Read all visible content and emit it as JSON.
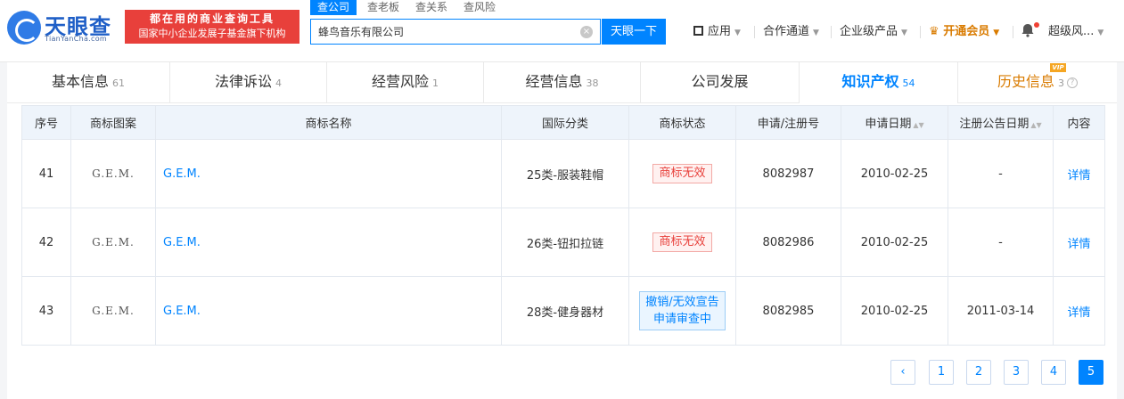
{
  "header": {
    "logo_text": "天眼查",
    "logo_sub": "TianYanCha.com",
    "promo_line1": "都在用的商业查询工具",
    "promo_line2": "国家中小企业发展子基金旗下机构",
    "search_tabs": [
      "查公司",
      "查老板",
      "查关系",
      "查风险"
    ],
    "search_value": "蜂鸟音乐有限公司",
    "clear_icon": "×",
    "search_button": "天眼一下",
    "nav": {
      "apps": "应用",
      "partner": "合作通道",
      "enterprise": "企业级产品",
      "vip": "开通会员",
      "user": "超级风..."
    }
  },
  "tabs": [
    {
      "label": "基本信息",
      "count": "61"
    },
    {
      "label": "法律诉讼",
      "count": "4"
    },
    {
      "label": "经营风险",
      "count": "1"
    },
    {
      "label": "经营信息",
      "count": "38"
    },
    {
      "label": "公司发展",
      "count": ""
    },
    {
      "label": "知识产权",
      "count": "54"
    },
    {
      "label": "历史信息",
      "count": "3"
    }
  ],
  "vip_badge": "VIP",
  "table": {
    "headers": [
      "序号",
      "商标图案",
      "商标名称",
      "国际分类",
      "商标状态",
      "申请/注册号",
      "申请日期",
      "注册公告日期",
      "内容"
    ],
    "rows": [
      {
        "no": "41",
        "image_text": "G.E.M.",
        "name": "G.E.M.",
        "class": "25类-服装鞋帽",
        "status": "商标无效",
        "reg_no": "8082987",
        "apply_date": "2010-02-25",
        "announce_date": "-",
        "detail": "详情"
      },
      {
        "no": "42",
        "image_text": "G.E.M.",
        "name": "G.E.M.",
        "class": "26类-钮扣拉链",
        "status": "商标无效",
        "reg_no": "8082986",
        "apply_date": "2010-02-25",
        "announce_date": "-",
        "detail": "详情"
      },
      {
        "no": "43",
        "image_text": "G.E.M.",
        "name": "G.E.M.",
        "class": "28类-健身器材",
        "status_line1": "撤销/无效宣告",
        "status_line2": "申请审查中",
        "reg_no": "8082985",
        "apply_date": "2010-02-25",
        "announce_date": "2011-03-14",
        "detail": "详情"
      }
    ]
  },
  "pagination": {
    "prev": "‹",
    "pages": [
      "1",
      "2",
      "3",
      "4",
      "5"
    ],
    "current": "5"
  }
}
